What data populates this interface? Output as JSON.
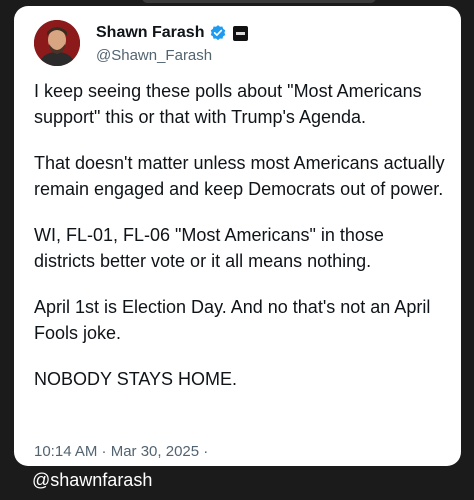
{
  "author": {
    "display_name": "Shawn Farash",
    "handle": "@Shawn_Farash"
  },
  "post": {
    "paragraphs": [
      "I keep seeing these polls about \"Most Americans support\" this or that with Trump's Agenda.",
      "That doesn't matter unless most Americans actually remain engaged and keep Democrats out of power.",
      "WI, FL-01, FL-06 \"Most Americans\" in those districts better vote or it all means nothing.",
      "April 1st is Election Day. And no that's not an April Fools joke.",
      "NOBODY STAYS HOME."
    ],
    "timestamp": "10:14 AM · Mar 30, 2025 ·"
  },
  "footer": {
    "credit": "@shawnfarash"
  },
  "colors": {
    "verified_badge": "#1d9bf0",
    "background": "#1b1b1b",
    "card": "#ffffff",
    "text_primary": "#0f1419",
    "text_secondary": "#536471"
  },
  "icons": [
    "verified-badge-icon",
    "affiliation-badge-icon"
  ]
}
